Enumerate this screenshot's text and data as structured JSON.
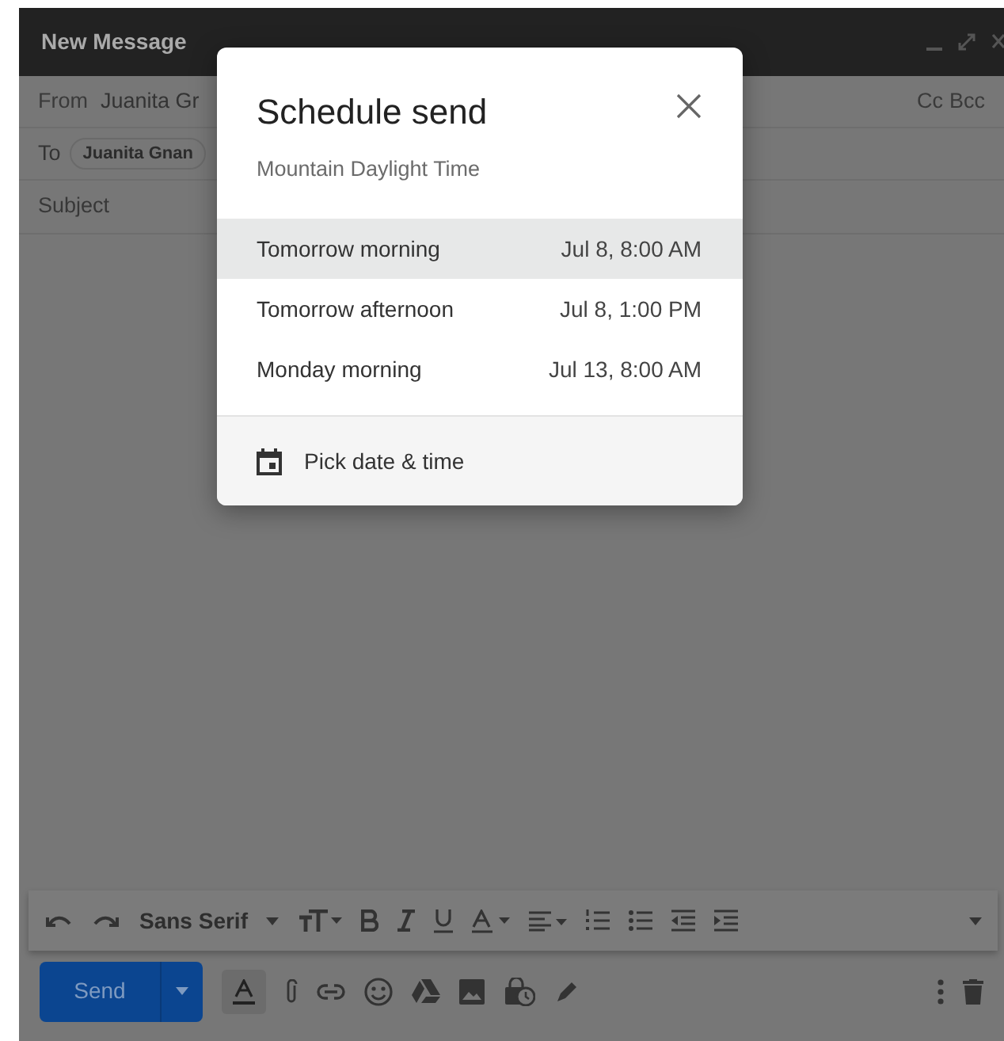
{
  "compose": {
    "title": "New Message",
    "from_label": "From",
    "from_value": "Juanita Gr",
    "to_label": "To",
    "to_chip": "Juanita Gnan",
    "cc": "Cc",
    "bcc": "Bcc",
    "subject_placeholder": "Subject",
    "font_name": "Sans Serif",
    "send": "Send"
  },
  "dialog": {
    "title": "Schedule send",
    "timezone": "Mountain Daylight Time",
    "options": [
      {
        "label": "Tomorrow morning",
        "time": "Jul 8, 8:00 AM",
        "selected": true
      },
      {
        "label": "Tomorrow afternoon",
        "time": "Jul 8, 1:00 PM",
        "selected": false
      },
      {
        "label": "Monday morning",
        "time": "Jul 13, 8:00 AM",
        "selected": false
      }
    ],
    "pick": "Pick date & time"
  }
}
